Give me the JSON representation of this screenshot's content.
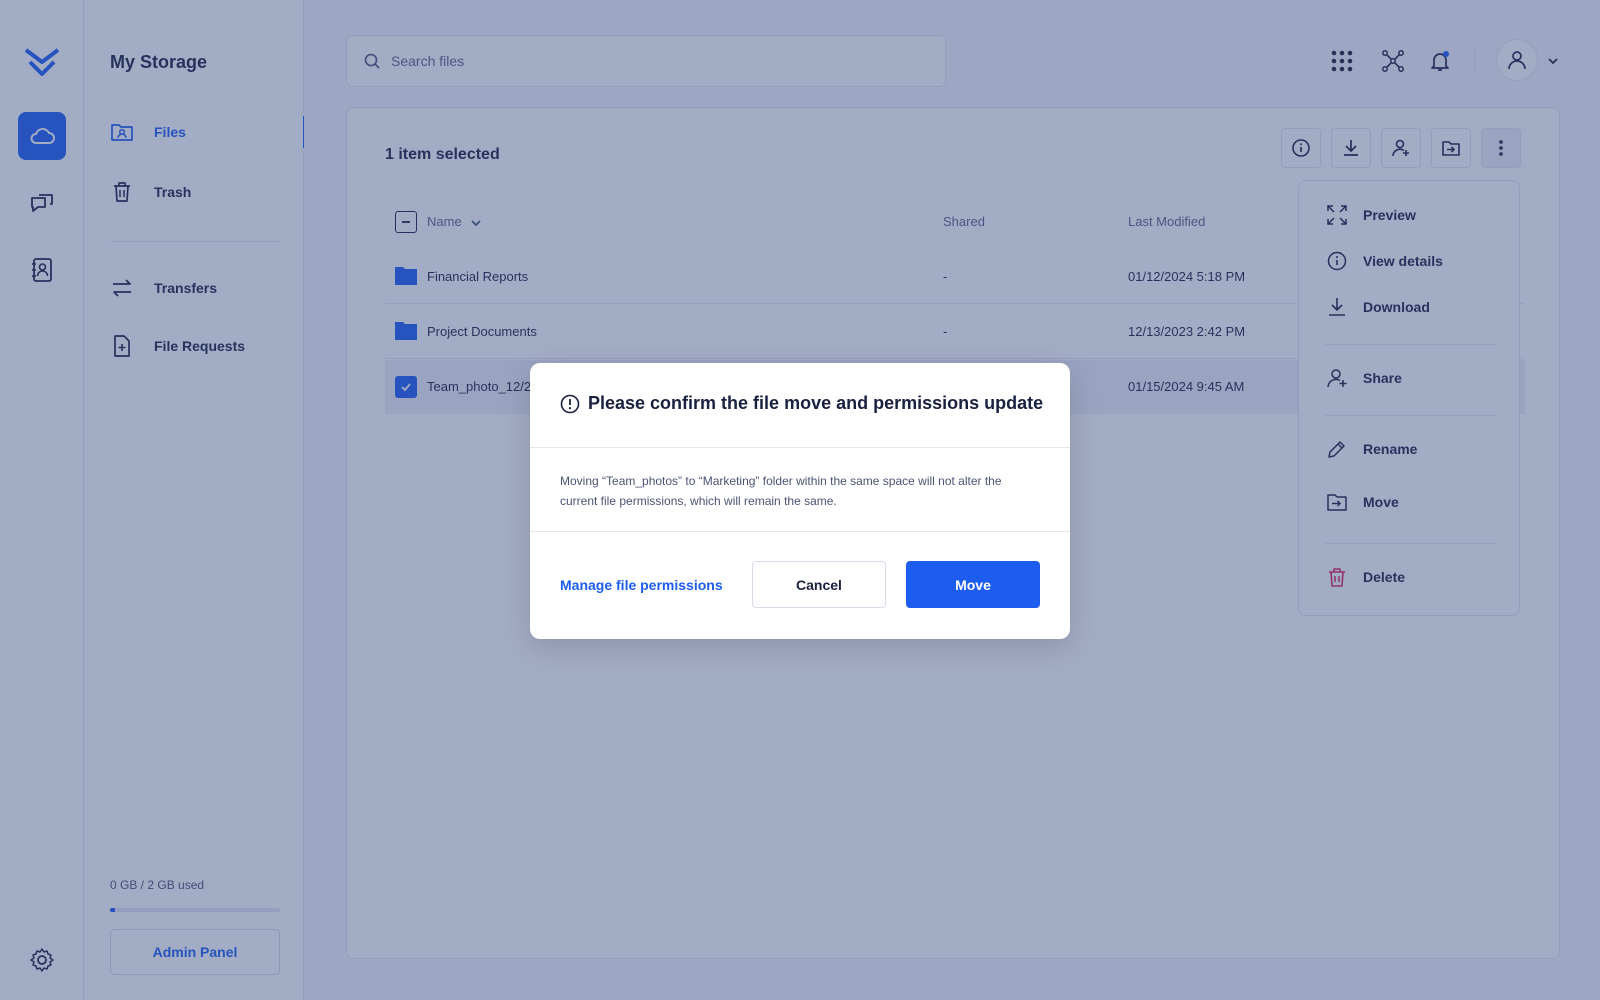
{
  "colors": {
    "accent": "#1c5df0",
    "overlay": "rgba(50,72,126,0.45)",
    "text": "#1a2140",
    "danger": "#e0245e"
  },
  "rail": {
    "icons": [
      "logo-chevrons-icon",
      "cloud-icon",
      "chat-icon",
      "contacts-icon",
      "gear-icon"
    ]
  },
  "sidebar": {
    "title": "My Storage",
    "items": [
      {
        "label": "Files",
        "icon": "folder-user-icon",
        "active": true
      },
      {
        "label": "Trash",
        "icon": "trash-icon"
      },
      {
        "label": "Transfers",
        "icon": "transfer-arrows-icon"
      },
      {
        "label": "File Requests",
        "icon": "file-plus-icon"
      }
    ],
    "storage_text": "0 GB / 2 GB used",
    "storage_used_fraction": 0.03,
    "admin_label": "Admin Panel"
  },
  "search": {
    "placeholder": "Search files"
  },
  "header_icons": [
    "apps-grid-icon",
    "network-icon",
    "bell-icon",
    "user-icon",
    "chevron-down-icon"
  ],
  "panel": {
    "selection_title": "1 item selected",
    "toolbar": [
      "info-icon",
      "download-icon",
      "share-user-icon",
      "move-folder-icon",
      "more-vertical-icon"
    ],
    "columns": {
      "name": "Name",
      "shared": "Shared",
      "modified": "Last Modified"
    },
    "rows": [
      {
        "name": "Financial Reports",
        "shared": "-",
        "modified": "01/12/2024  5:18 PM",
        "type": "folder"
      },
      {
        "name": "Project Documents",
        "shared": "-",
        "modified": "12/13/2023  2:42 PM",
        "type": "folder"
      },
      {
        "name": "Team_photo_12/2",
        "shared": "",
        "modified": "01/15/2024 9:45 AM",
        "type": "file",
        "selected": true
      }
    ]
  },
  "menu": {
    "items": [
      {
        "label": "Preview",
        "icon": "expand-icon"
      },
      {
        "label": "View details",
        "icon": "info-icon"
      },
      {
        "label": "Download",
        "icon": "download-icon"
      },
      {
        "label": "Share",
        "icon": "share-user-icon"
      },
      {
        "label": "Rename",
        "icon": "pencil-icon"
      },
      {
        "label": "Move",
        "icon": "move-folder-icon"
      },
      {
        "label": "Delete",
        "icon": "trash-icon"
      }
    ]
  },
  "modal": {
    "title": "Please confirm the file move and permissions update",
    "body": "Moving “Team_photos” to “Marketing” folder within the same space will not alter the current file permissions, which will remain the same.",
    "link_label": "Manage file permissions",
    "cancel_label": "Cancel",
    "confirm_label": "Move"
  }
}
